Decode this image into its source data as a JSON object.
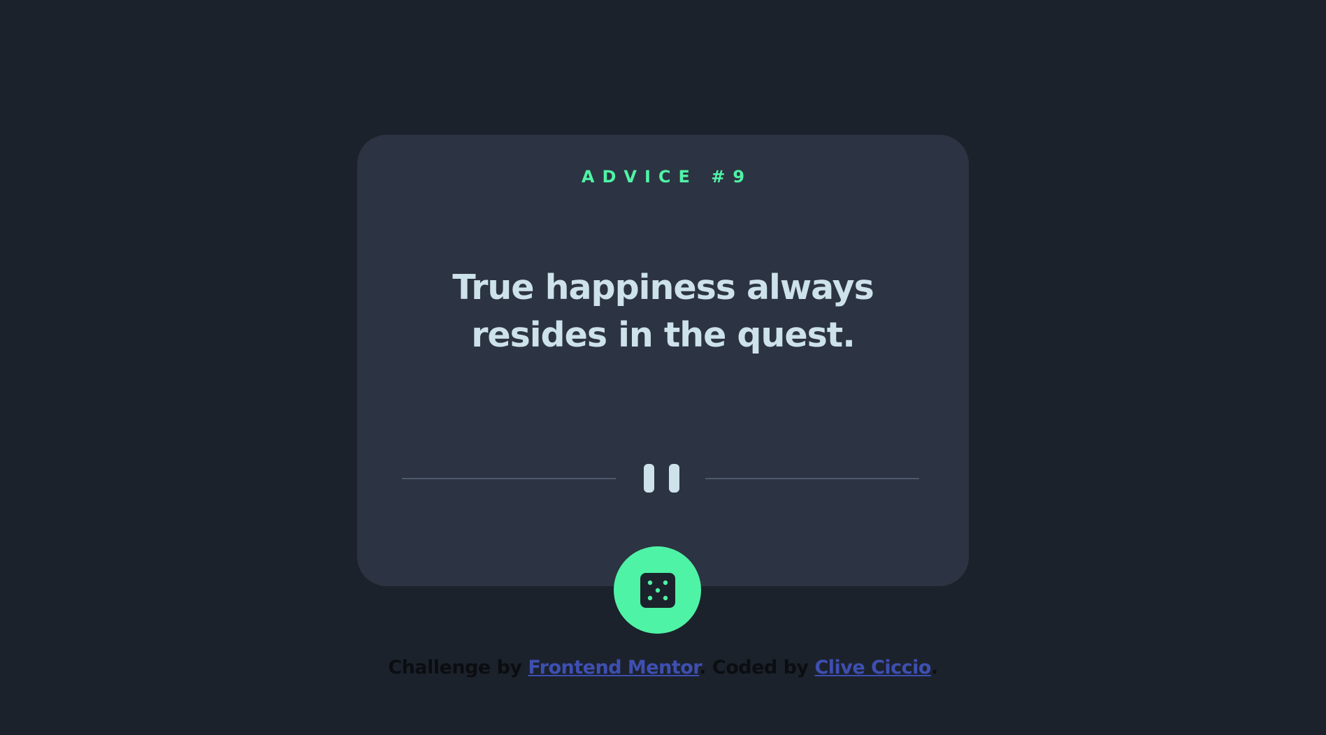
{
  "card": {
    "label": "ADVICE #9",
    "advice": "True happiness always resides in the quest."
  },
  "icons": {
    "divider": "pause-icon",
    "button": "dice-icon"
  },
  "footer": {
    "prefix": "Challenge by ",
    "link1": "Frontend Mentor",
    "middle": ". Coded by ",
    "link2": "Clive Ciccio",
    "suffix": "."
  },
  "colors": {
    "background": "#1c222c",
    "card": "#2c3342",
    "accent": "#4ff3a6",
    "text": "#cde2ea",
    "link": "#3e4fb1"
  }
}
